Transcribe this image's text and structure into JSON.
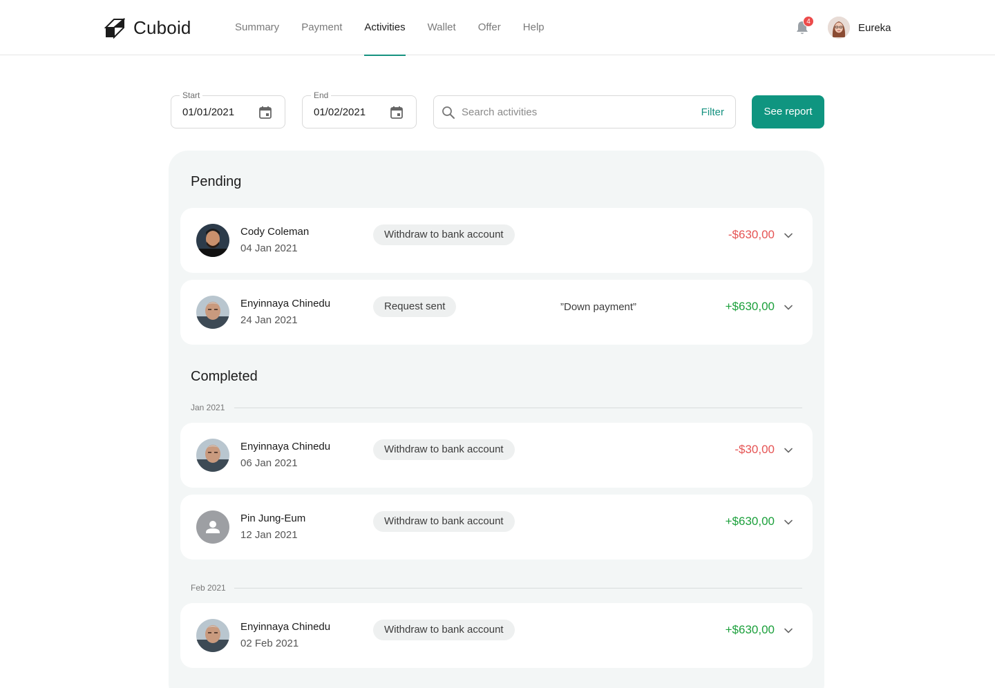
{
  "app": {
    "name": "Cuboid"
  },
  "nav": [
    {
      "label": "Summary",
      "active": false
    },
    {
      "label": "Payment",
      "active": false
    },
    {
      "label": "Activities",
      "active": true
    },
    {
      "label": "Wallet",
      "active": false
    },
    {
      "label": "Offer",
      "active": false
    },
    {
      "label": "Help",
      "active": false
    }
  ],
  "notifications": {
    "count": "4"
  },
  "user": {
    "name": "Eureka"
  },
  "filters": {
    "start": {
      "label": "Start",
      "value": "01/01/2021"
    },
    "end": {
      "label": "End",
      "value": "01/02/2021"
    },
    "search_placeholder": "Search activities",
    "filter_label": "Filter",
    "report_label": "See report"
  },
  "pending": {
    "title": "Pending",
    "items": [
      {
        "name": "Cody Coleman",
        "date": "04 Jan 2021",
        "type": "Withdraw to bank account",
        "note": "",
        "amount": "-$630,00",
        "direction": "negative"
      },
      {
        "name": "Enyinnaya Chinedu",
        "date": "24 Jan 2021",
        "type": "Request sent",
        "note": "”Down payment”",
        "amount": "+$630,00",
        "direction": "positive"
      }
    ]
  },
  "completed": {
    "title": "Completed",
    "groups": [
      {
        "month": "Jan 2021",
        "items": [
          {
            "name": "Enyinnaya Chinedu",
            "date": "06 Jan 2021",
            "type": "Withdraw to bank account",
            "amount": "-$30,00",
            "direction": "negative"
          },
          {
            "name": "Pin Jung-Eum",
            "date": "12 Jan 2021",
            "type": "Withdraw to bank account",
            "amount": "+$630,00",
            "direction": "positive"
          }
        ]
      },
      {
        "month": "Feb 2021",
        "items": [
          {
            "name": "Enyinnaya Chinedu",
            "date": "02 Feb 2021",
            "type": "Withdraw to bank account",
            "amount": "+$630,00",
            "direction": "positive"
          }
        ]
      }
    ]
  },
  "colors": {
    "accent": "#0f9580",
    "negative": "#e55353",
    "positive": "#1a9f3a",
    "panel": "#f3f6f6"
  }
}
